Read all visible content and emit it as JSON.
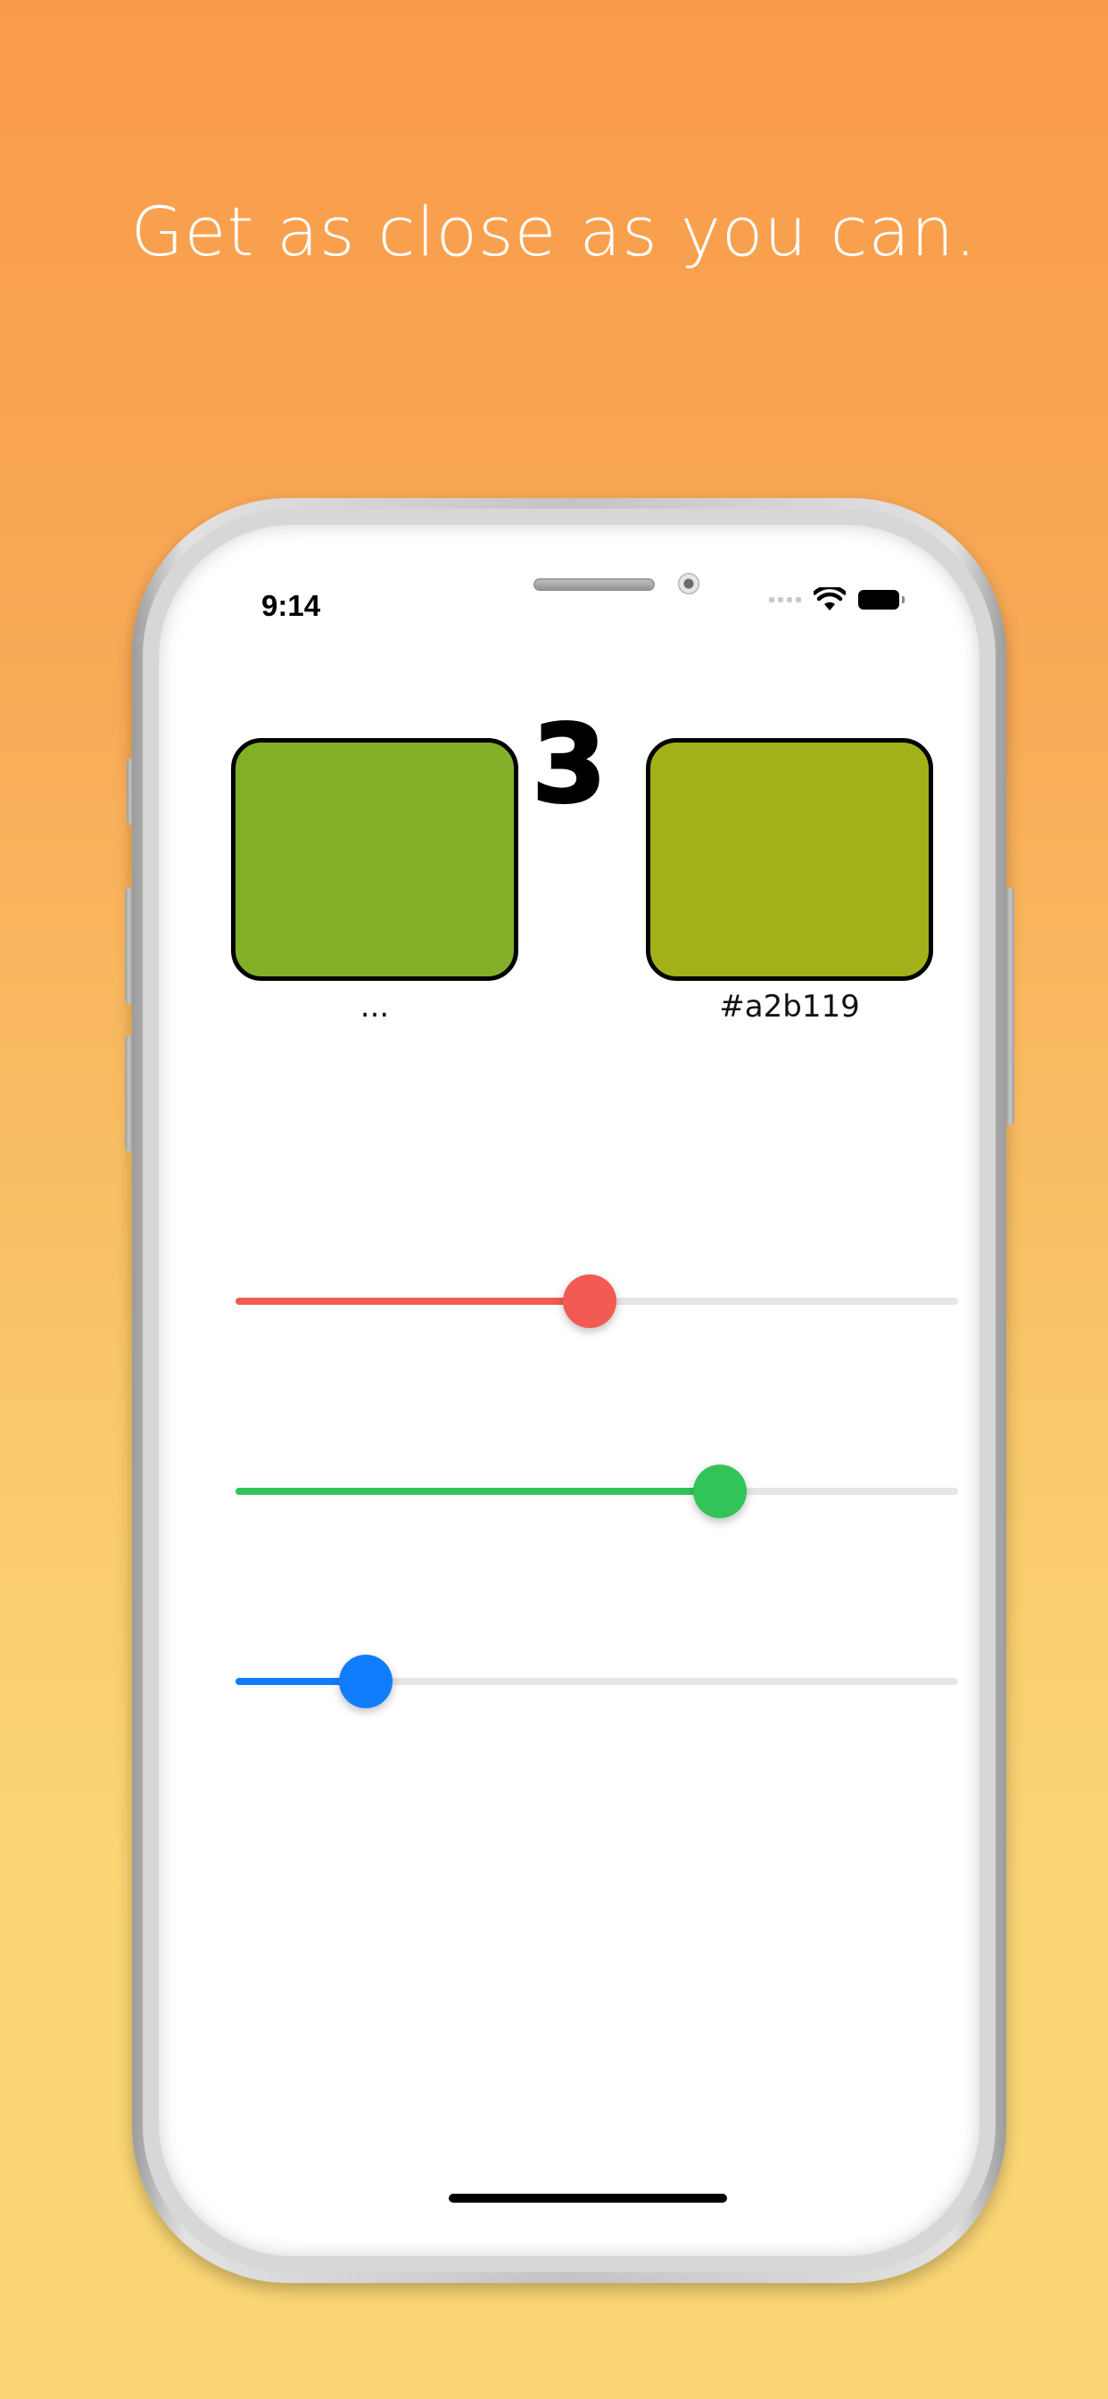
{
  "promo": {
    "headline": "Get as close as you can."
  },
  "status_bar": {
    "time": "9:14",
    "signal_icon": "cellular-dots-icon",
    "wifi_icon": "wifi-icon",
    "battery_icon": "battery-full-icon"
  },
  "game": {
    "target_swatch": {
      "color": "#82b028",
      "label": "..."
    },
    "guess_swatch": {
      "color": "#a2b119",
      "label": "#a2b119"
    },
    "score": "3",
    "sliders": [
      {
        "name": "red",
        "color": "#f15b52",
        "value": 0.49
      },
      {
        "name": "green",
        "color": "#33c459",
        "value": 0.67
      },
      {
        "name": "blue",
        "color": "#127dfc",
        "value": 0.18
      }
    ]
  }
}
